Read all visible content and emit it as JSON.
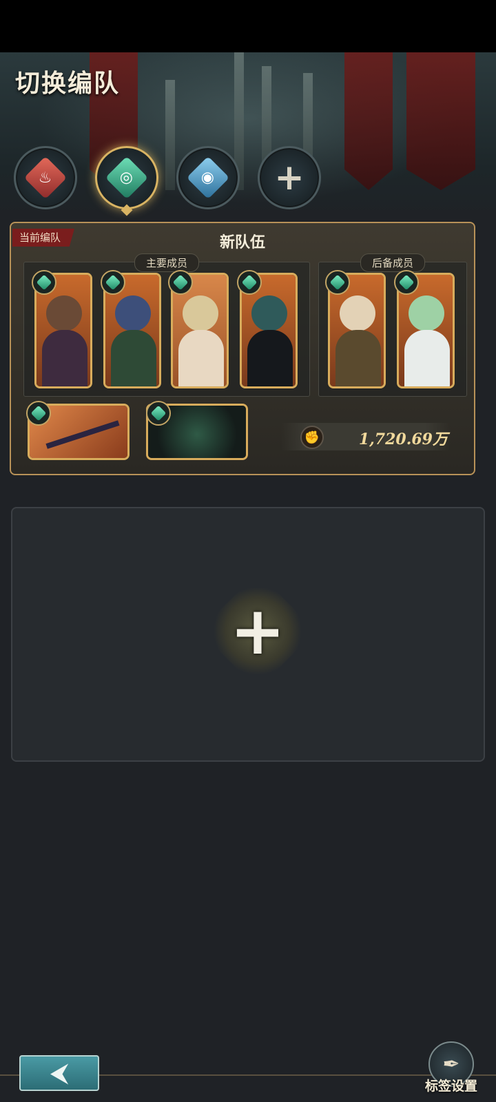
{
  "screen": {
    "title": "切换编队"
  },
  "tabs": [
    {
      "name": "fire",
      "icon": "fire-element-icon",
      "active": false
    },
    {
      "name": "wind",
      "icon": "wind-element-icon",
      "active": true
    },
    {
      "name": "water",
      "icon": "water-element-icon",
      "active": false
    },
    {
      "name": "add",
      "icon": "plus-icon",
      "active": false
    }
  ],
  "team": {
    "current_tag": "当前编队",
    "name": "新队伍",
    "main_label": "主要成员",
    "reserve_label": "后备成员",
    "power_value": "1,720.69万",
    "power_icon": "fist-icon"
  },
  "empty_slot": {
    "icon": "plus-icon"
  },
  "footer": {
    "back_icon": "back-arrow-icon",
    "back_glyph": "⮜",
    "tag_settings_label": "标签设置",
    "tag_settings_icon": "feather-quill-icon"
  },
  "colors": {
    "accent_gold": "#d8ac5c",
    "tag_red": "#7a1d1d",
    "wind_green": "#1f8a66",
    "back_teal": "#2c6d76"
  }
}
